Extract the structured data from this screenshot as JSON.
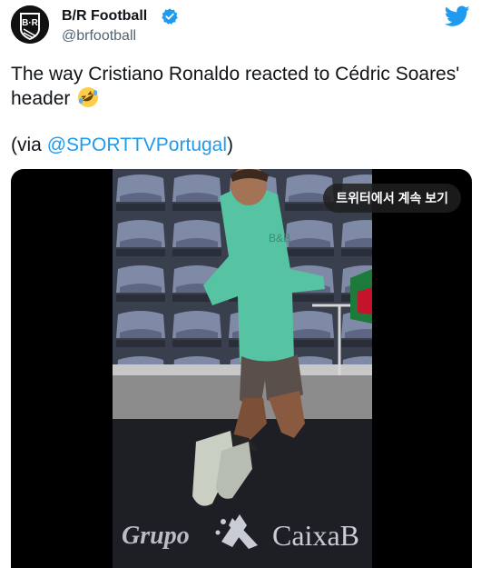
{
  "author": {
    "name": "B/R Football",
    "handle": "@brfootball",
    "avatar_text": "B·R"
  },
  "tweet": {
    "text": "The way Cristiano Ronaldo reacted to Cédric Soares' header",
    "emoji": "rolling-on-floor-laughing",
    "via_prefix": "(via ",
    "via_link": "@SPORTTVPortugal",
    "via_suffix": ")"
  },
  "media": {
    "continue_label": "트위터에서 계속 보기",
    "sponsor_left": "Grupo",
    "sponsor_right": "CaixaB",
    "shirt_text": "B&B"
  },
  "colors": {
    "link": "#1d9bf0",
    "verified": "#1d9bf0",
    "handle": "#536471"
  }
}
